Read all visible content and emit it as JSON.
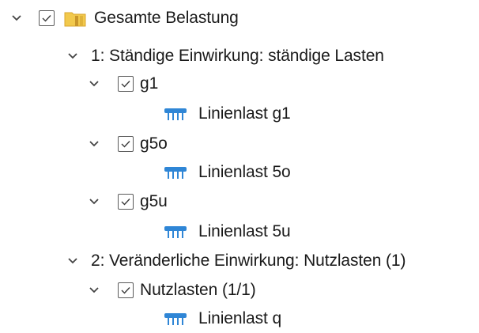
{
  "tree": {
    "root": {
      "label": "Gesamte Belastung",
      "checked": true,
      "expanded": true,
      "icon": "folder-icon"
    },
    "groups": [
      {
        "label": "1: Ständige Einwirkung: ständige Lasten",
        "expanded": true,
        "children": [
          {
            "label": "g1",
            "checked": true,
            "expanded": true,
            "loads": [
              {
                "label": "Linienlast g1",
                "icon": "line-load-icon"
              }
            ]
          },
          {
            "label": "g5o",
            "checked": true,
            "expanded": true,
            "loads": [
              {
                "label": "Linienlast 5o",
                "icon": "line-load-icon"
              }
            ]
          },
          {
            "label": "g5u",
            "checked": true,
            "expanded": true,
            "loads": [
              {
                "label": "Linienlast 5u",
                "icon": "line-load-icon"
              }
            ]
          }
        ]
      },
      {
        "label": "2: Veränderliche Einwirkung: Nutzlasten (1)",
        "expanded": true,
        "children": [
          {
            "label": "Nutzlasten (1/1)",
            "checked": true,
            "expanded": true,
            "loads": [
              {
                "label": "Linienlast q",
                "icon": "line-load-icon"
              }
            ]
          }
        ]
      }
    ]
  },
  "colors": {
    "folder": "#f2c94c",
    "folder_dark": "#d9a62e",
    "load_icon": "#2f86d6",
    "chevron": "#444444",
    "text": "#1a1a1a"
  }
}
